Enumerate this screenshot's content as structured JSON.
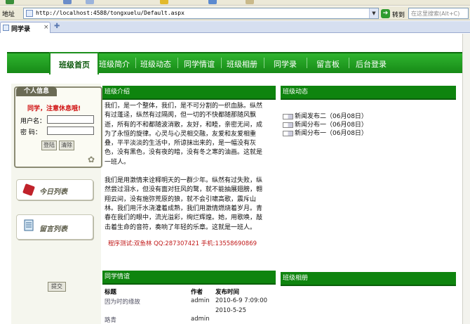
{
  "browser": {
    "address_label": "地址",
    "url": "http://localhost:4588/tongxuelu/Default.aspx",
    "go_label": "转到",
    "search_placeholder": "在这里搜索(Alt+C)",
    "tab_label": "同学录",
    "tab_close": "×",
    "new_tab": "✚"
  },
  "nav": {
    "items": [
      "班级首页",
      "班级简介",
      "班级动态",
      "同学情谊",
      "班级相册",
      "同学录",
      "留言板",
      "后台登录"
    ],
    "active": "班级首页"
  },
  "login": {
    "title": "个人信息",
    "warning": "同学，注意休息哦!",
    "user_label": "用户名：",
    "pass_label": "密  码：",
    "login_button": "登陆",
    "clear_button": "清除"
  },
  "side": {
    "today_button": "今日列表",
    "message_button": "留言列表",
    "submit_button": "提交"
  },
  "intro": {
    "title": "班级介绍",
    "paragraphs": [
      "我们，是一个整体，我们，是不可分割的一织血脉。纵然有过蓬迳，纵然有过隔阂，但一切的不快都随那随风飘逝，所有的不和都随波消散，友好，和睦，亲密无间，成为了永恒的旋律。心灵与心灵相交融，友爱和友爱相重叠，平平淡淡的生活中，所谅抹出来的，是一幅没有灰色，没有黑色，没有夜的暗，没有冬之寒的油画。这就是一班人。",
      "我们是用激情来诠释明天的一群少年。纵然有过失败，纵然尝过泪水，但没有面对狂风的鹜，就不能抽展翅膀，翱翔云间，没有施弥荒原的狼，就不会引啸高歌，震斥山林。我们用汗水浇灌着成熟，我们用激情燃烧着岁月。青春在我们的眼中，流光溢彩，绚烂辉煌。她，用歌唤，敲击着生命的音符，奏响了年轻的乐章。这就是一班人。"
    ],
    "contact": "程序测试:双鱼林  QQ:287307421  手机:13558690869"
  },
  "news": {
    "title": "班级动态",
    "items": [
      {
        "label": "新闻发布二",
        "date": "（06月08日）"
      },
      {
        "label": "新闻分布一",
        "date": "（06月08日）"
      },
      {
        "label": "新闻分布一",
        "date": "（06月08日）"
      }
    ]
  },
  "friendship": {
    "title": "同学情谊",
    "columns": [
      "标题",
      "作者",
      "发布时间"
    ],
    "rows": [
      {
        "title": "因为时的缘故",
        "author": "admin",
        "time": "2010-6-9 7:09:00"
      },
      {
        "title": "",
        "author": "",
        "time": "2010-5-25"
      },
      {
        "title": "路青",
        "author": "admin",
        "time": ""
      }
    ]
  },
  "album": {
    "title": "班级相册"
  }
}
